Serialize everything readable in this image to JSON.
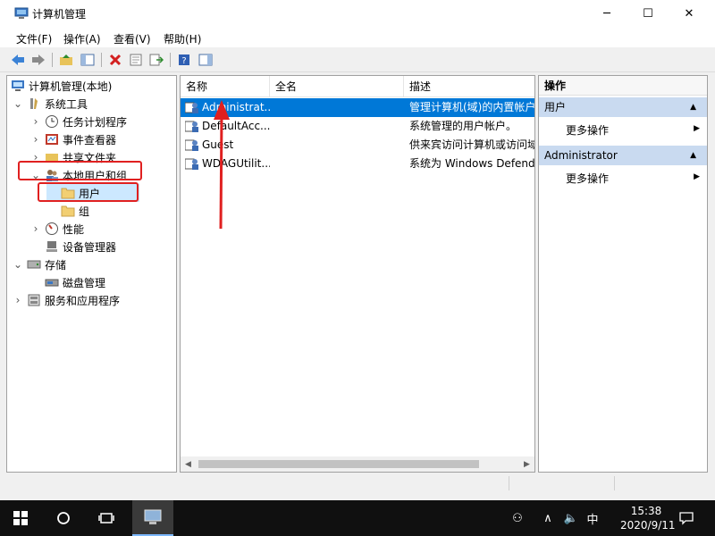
{
  "window": {
    "title": "计算机管理",
    "minimize_glyph": "─",
    "maximize_glyph": "☐",
    "close_glyph": "✕"
  },
  "menu": [
    "文件(F)",
    "操作(A)",
    "查看(V)",
    "帮助(H)"
  ],
  "toolbar": {
    "icons": [
      "back-arrow-icon",
      "forward-arrow-icon",
      "up-folder-icon",
      "show-hide-tree-icon",
      "delete-icon",
      "properties-icon",
      "export-list-icon",
      "help-icon",
      "show-hide-action-pane-icon"
    ]
  },
  "tree": {
    "root": "计算机管理(本地)",
    "system_tools": "系统工具",
    "task_scheduler": "任务计划程序",
    "event_viewer": "事件查看器",
    "shared_folders": "共享文件夹",
    "local_users_groups": "本地用户和组",
    "users": "用户",
    "groups": "组",
    "performance": "性能",
    "device_manager": "设备管理器",
    "storage": "存储",
    "disk_management": "磁盘管理",
    "services_apps": "服务和应用程序"
  },
  "list": {
    "columns": [
      "名称",
      "全名",
      "描述"
    ],
    "rows": [
      {
        "name": "Administrat...",
        "fullname": "",
        "desc": "管理计算机(域)的内置帐户"
      },
      {
        "name": "DefaultAcc...",
        "fullname": "",
        "desc": "系统管理的用户帐户。"
      },
      {
        "name": "Guest",
        "fullname": "",
        "desc": "供来宾访问计算机或访问域"
      },
      {
        "name": "WDAGUtilit...",
        "fullname": "",
        "desc": "系统为 Windows Defend"
      }
    ]
  },
  "actions": {
    "title": "操作",
    "section1": "用户",
    "section1_item": "更多操作",
    "section2": "Administrator",
    "section2_item": "更多操作"
  },
  "taskbar": {
    "ime": "中",
    "time": "15:38",
    "date": "2020/9/11"
  },
  "colors": {
    "selection": "#0078d7",
    "tree_selection": "#cce8ff",
    "annotation_red": "#e02020",
    "actions_section": "#c9daf0",
    "taskbar": "#101010"
  }
}
